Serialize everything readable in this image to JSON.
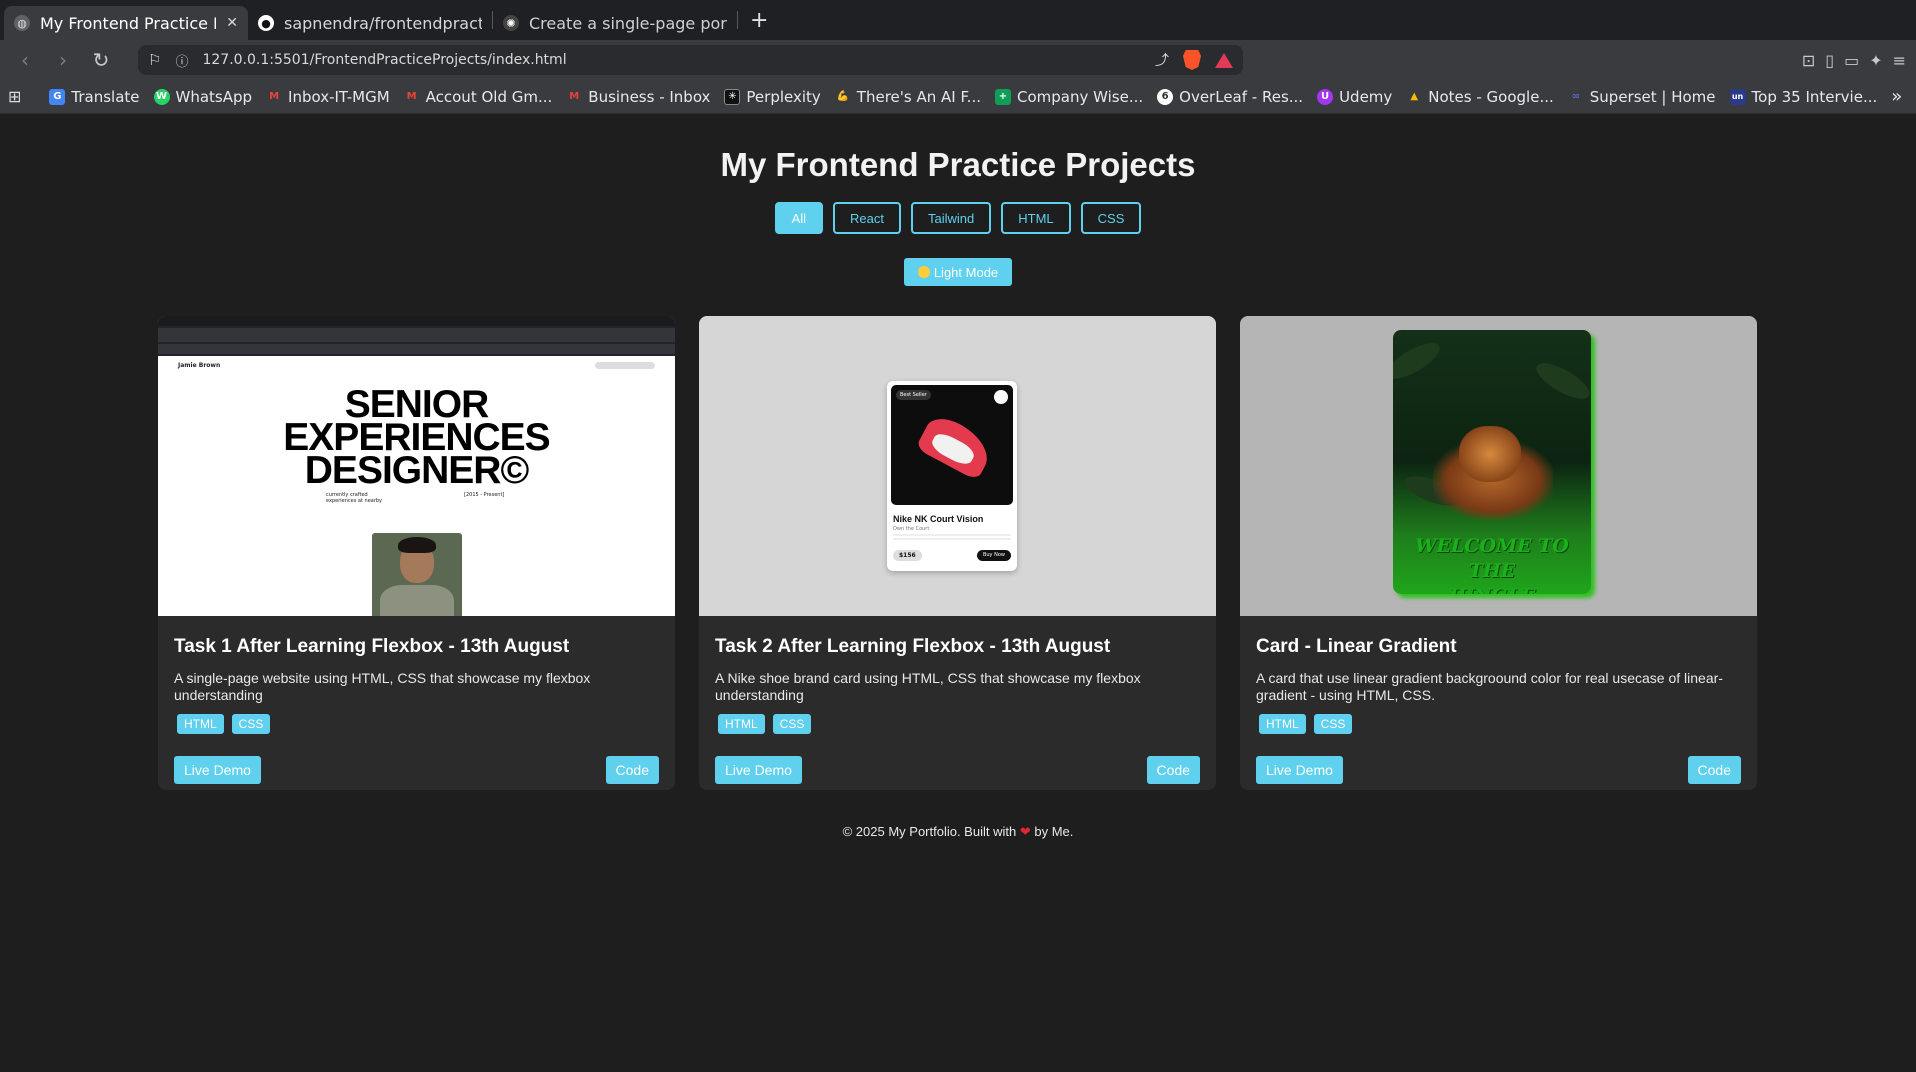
{
  "browser": {
    "tabs": [
      {
        "title": "My Frontend Practice Pro",
        "active": true
      },
      {
        "title": "sapnendra/frontendpractice",
        "active": false
      },
      {
        "title": "Create a single-page portfolio",
        "active": false
      }
    ],
    "url": "127.0.0.1:5501/FrontendPracticeProjects/index.html",
    "bookmarks": [
      {
        "label": "Translate",
        "color": "#4285f4",
        "glyph": "G"
      },
      {
        "label": "WhatsApp",
        "color": "#25d366",
        "glyph": "W"
      },
      {
        "label": "Inbox-IT-MGM",
        "color": "#ea4335",
        "glyph": "M"
      },
      {
        "label": "Accout Old Gm...",
        "color": "#ea4335",
        "glyph": "M"
      },
      {
        "label": "Business - Inbox",
        "color": "#ea4335",
        "glyph": "M"
      },
      {
        "label": "Perplexity",
        "color": "#20808d",
        "glyph": "P"
      },
      {
        "label": "There's An AI F...",
        "color": "#888888",
        "glyph": "T"
      },
      {
        "label": "Company Wise...",
        "color": "#0f9d58",
        "glyph": "+"
      },
      {
        "label": "OverLeaf - Res...",
        "color": "#4caf50",
        "glyph": "O"
      },
      {
        "label": "Udemy",
        "color": "#a435f0",
        "glyph": "U"
      },
      {
        "label": "Notes - Google...",
        "color": "#fbbc04",
        "glyph": "D"
      },
      {
        "label": "Superset | Home",
        "color": "#5a6ad8",
        "glyph": "S"
      },
      {
        "label": "Top 35 Intervie...",
        "color": "#2b3b8a",
        "glyph": "un"
      }
    ]
  },
  "page": {
    "title": "My Frontend Practice Projects",
    "filters": [
      "All",
      "React",
      "Tailwind",
      "HTML",
      "CSS"
    ],
    "active_filter": "All",
    "mode_button": "Light Mode",
    "projects": [
      {
        "title": "Task 1 After Learning Flexbox - 13th August",
        "description": "A single-page website using HTML, CSS that showcase my flexbox understanding",
        "tags": [
          "HTML",
          "CSS"
        ],
        "demo_label": "Live Demo",
        "code_label": "Code",
        "preview": {
          "brand": "Jamie Brown",
          "headline_1": "SENIOR",
          "headline_2": "EXPERIENCES",
          "headline_3": "DESIGNER©",
          "sub_left": "currently crafted experiences at nearby",
          "sub_right": "[2015 - Present]"
        }
      },
      {
        "title": "Task 2 After Learning Flexbox - 13th August",
        "description": "A Nike shoe brand card using HTML, CSS that showcase my flexbox understanding",
        "tags": [
          "HTML",
          "CSS"
        ],
        "demo_label": "Live Demo",
        "code_label": "Code",
        "preview": {
          "badge": "Best Seller",
          "name": "Nike NK Court Vision",
          "subtitle": "Own the Court",
          "price": "$156",
          "buy": "Buy Now"
        }
      },
      {
        "title": "Card - Linear Gradient",
        "description": "A card that use linear gradient backgroound color for real usecase of linear-gradient - using HTML, CSS.",
        "tags": [
          "HTML",
          "CSS"
        ],
        "demo_label": "Live Demo",
        "code_label": "Code",
        "preview": {
          "text": "WELCOME TO THE JUNGLE"
        }
      }
    ],
    "footer_pre": "© 2025 My Portfolio. Built with",
    "footer_post": "by Me."
  },
  "colors": {
    "accent": "#5fd0ee",
    "background": "#1e1e1e",
    "card": "#2b2b2b"
  }
}
